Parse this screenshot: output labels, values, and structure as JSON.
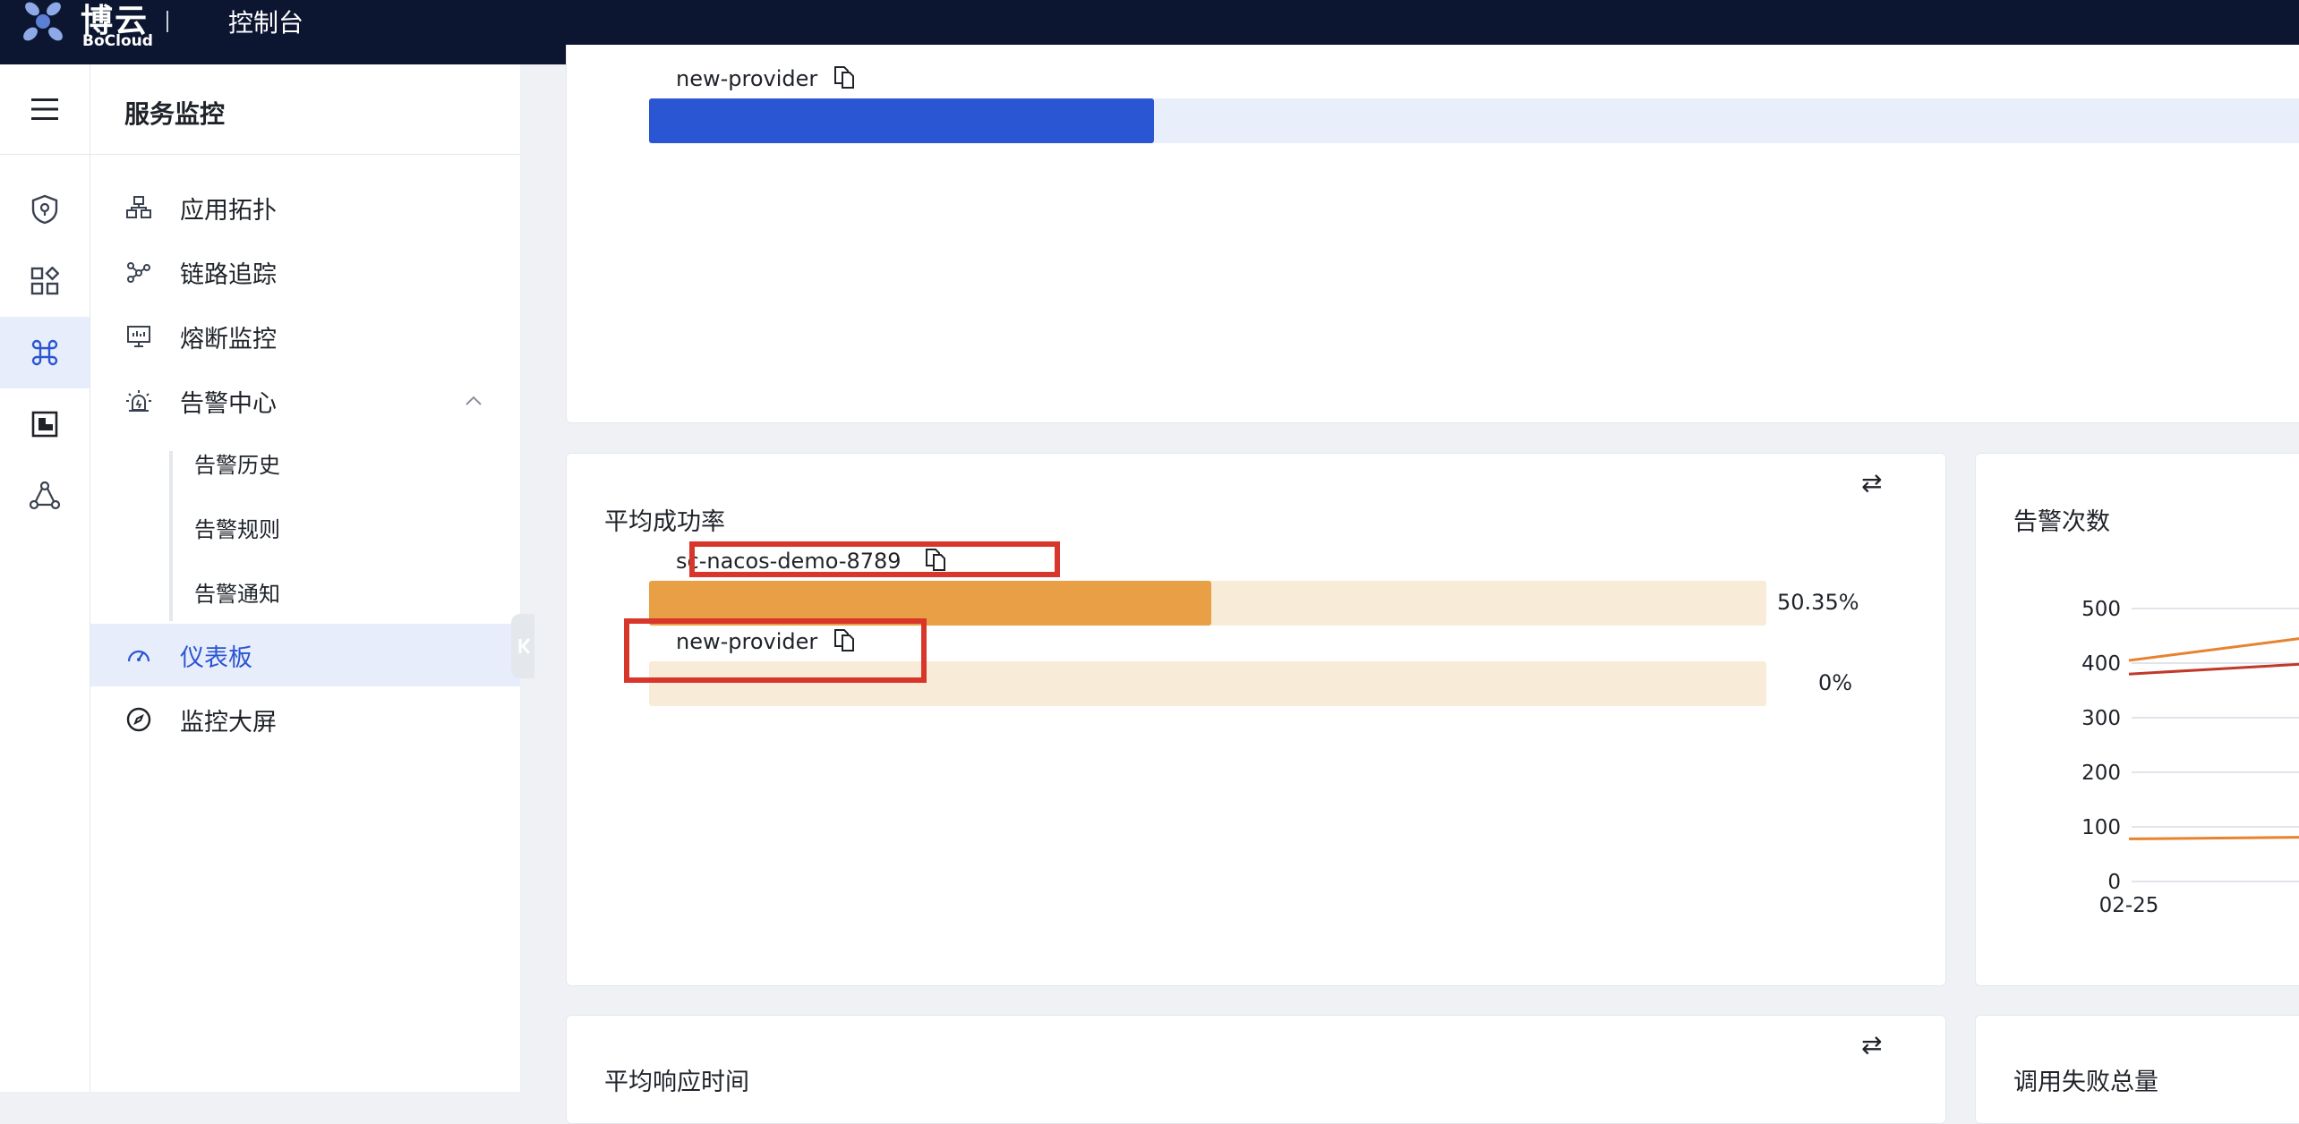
{
  "header": {
    "logo_cn": "博云",
    "logo_en": "BoCloud",
    "separator": "|",
    "title": "控制台"
  },
  "sidebar": {
    "title": "服务监控",
    "items": [
      {
        "label": "应用拓扑",
        "icon": "topology-icon"
      },
      {
        "label": "链路追踪",
        "icon": "trace-icon"
      },
      {
        "label": "熔断监控",
        "icon": "monitor-icon"
      },
      {
        "label": "告警中心",
        "icon": "alarm-icon"
      },
      {
        "label": "仪表板",
        "icon": "dashboard-icon",
        "active": true
      },
      {
        "label": "监控大屏",
        "icon": "compass-icon"
      }
    ],
    "alarm_sub_items": [
      "告警历史",
      "告警规则",
      "告警通知"
    ]
  },
  "cards": {
    "top": {
      "service": "new-provider",
      "fill_fraction": 0.3
    },
    "success_rate": {
      "title": "平均成功率",
      "rows": [
        {
          "service": "sc-nacos-demo-8789",
          "value": "50.35%",
          "fill_fraction": 0.5035
        },
        {
          "service": "new-provider",
          "value": "0%",
          "fill_fraction": 0
        }
      ]
    },
    "alarm_count": {
      "title": "告警次数"
    },
    "response_time": {
      "title": "平均响应时间"
    },
    "fail_total": {
      "title": "调用失败总量"
    }
  },
  "chart_data": {
    "type": "line",
    "title": "告警次数",
    "x": [
      "02-25"
    ],
    "yticks": [
      "500",
      "400",
      "300",
      "200",
      "100",
      "0"
    ],
    "ylim": [
      0,
      500
    ],
    "series": [
      {
        "color": "#e8822e",
        "values": [
          405
        ]
      },
      {
        "color": "#c0392b",
        "values": [
          380
        ]
      },
      {
        "color": "#e8822e",
        "values": [
          78
        ]
      }
    ]
  },
  "colors": {
    "accent": "#2a55d3",
    "topbar": "#0d1631",
    "bar_orange": "#e89f45",
    "bar_orange_track": "#f8ebd7",
    "bar_blue": "#2a55d3",
    "bar_blue_track": "#e8effa",
    "highlight_red": "#d9362b"
  }
}
